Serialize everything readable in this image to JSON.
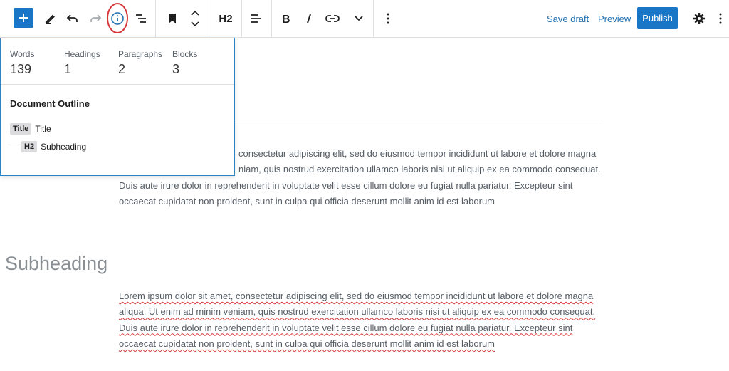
{
  "toolbar": {
    "add_icon": "plus-icon",
    "tools_icon": "pencil-icon",
    "undo_icon": "undo-icon",
    "redo_icon": "redo-icon",
    "info_icon": "info-icon",
    "list_view_icon": "list-view-icon",
    "block_icon": "bookmark-icon",
    "heading_level": "H2",
    "save_draft_label": "Save draft",
    "preview_label": "Preview",
    "publish_label": "Publish",
    "accent_color": "#1976c7",
    "highlight_color": "#d63638"
  },
  "info_panel": {
    "stats": [
      {
        "label": "Words",
        "value": "139"
      },
      {
        "label": "Headings",
        "value": "1"
      },
      {
        "label": "Paragraphs",
        "value": "2"
      },
      {
        "label": "Blocks",
        "value": "3"
      }
    ],
    "outline_title": "Document Outline",
    "outline": [
      {
        "badge": "Title",
        "text": "Title"
      },
      {
        "badge": "H2",
        "text": "Subheading"
      }
    ]
  },
  "editor": {
    "paragraph1_lines": [
      "consectetur adipiscing elit, sed do eiusmod tempor incididunt ut labore et dolore magna",
      "niam, quis nostrud exercitation ullamco laboris nisi ut aliquip ex ea commodo consequat.",
      "Duis aute irure dolor in reprehenderit in voluptate velit esse cillum dolore eu fugiat nulla pariatur. Excepteur sint",
      "occaecat cupidatat non proident, sunt in culpa qui officia deserunt mollit anim id est laborum"
    ],
    "subheading": "Subheading",
    "paragraph2_lines": [
      "Lorem ipsum dolor sit amet, consectetur adipiscing elit, sed do eiusmod tempor incididunt ut labore et dolore magna",
      "aliqua. Ut enim ad minim veniam, quis nostrud exercitation ullamco laboris nisi ut aliquip ex ea commodo consequat.",
      "Duis aute irure dolor in reprehenderit in voluptate velit esse cillum dolore eu fugiat nulla pariatur. Excepteur sint",
      "occaecat cupidatat non proident, sunt in culpa qui officia deserunt mollit anim id est laborum"
    ]
  }
}
